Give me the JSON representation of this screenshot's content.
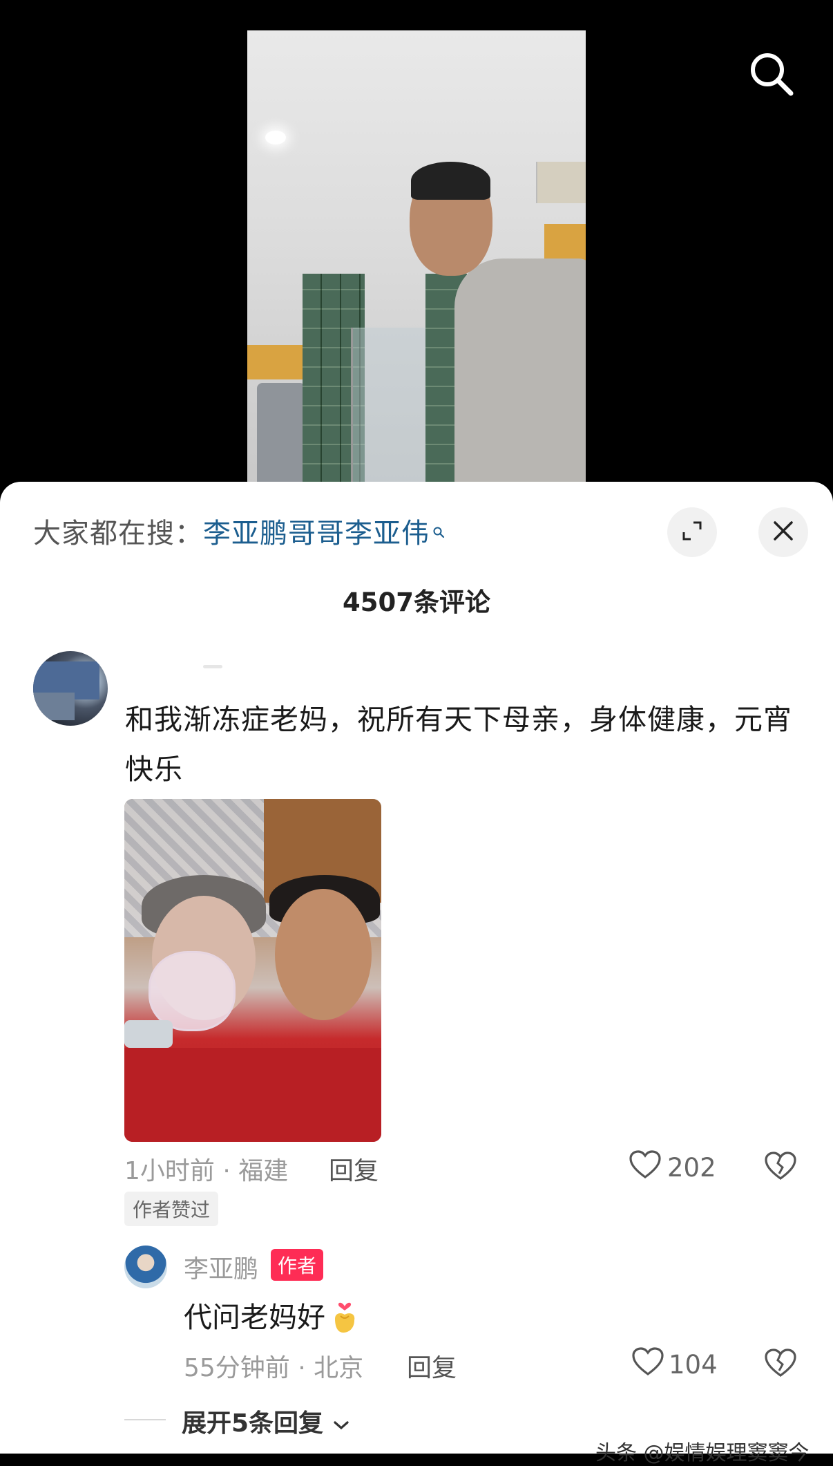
{
  "hot_search": {
    "lead": "大家都在搜：",
    "keyword": "李亚鹏哥哥李亚伟"
  },
  "comments_header": {
    "count_label": "4507条评论"
  },
  "comment": {
    "text": "和我渐冻症老妈，祝所有天下母亲，身体健康，元宵快乐",
    "meta": "1小时前 · 福建",
    "reply_label": "回复",
    "likes": "202",
    "author_liked_tag": "作者赞过"
  },
  "reply": {
    "username": "李亚鹏",
    "badge": "作者",
    "text": "代问老妈好",
    "meta": "55分钟前 · 北京",
    "reply_label": "回复",
    "likes": "104"
  },
  "expand": {
    "label": "展开5条回复"
  },
  "watermark": "头条 @娱情娱理窦窦今",
  "colors": {
    "keyword": "#1c5e8f",
    "author_badge": "#fe2c55",
    "sheet_bg": "#ffffff",
    "video_bg": "#000000"
  },
  "icons": [
    "search-icon",
    "fullscreen-icon",
    "close-icon",
    "heart-icon",
    "broken-heart-icon",
    "chevron-down-icon",
    "finger-heart-emoji"
  ]
}
